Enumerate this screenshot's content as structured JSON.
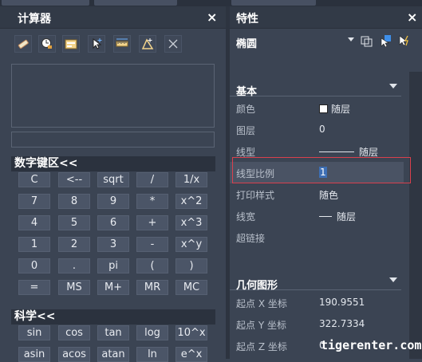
{
  "calculator": {
    "title": "计算器",
    "close": "×",
    "toolbar_icons": [
      "eraser-icon",
      "clock-icon",
      "units-icon",
      "pick-point-icon",
      "measure-distance-icon",
      "angle-icon",
      "close-x-icon"
    ],
    "display_value": "",
    "input_value": "",
    "numpad": {
      "header": "数字键区<<",
      "rows": [
        [
          "C",
          "<--",
          "sqrt",
          "/",
          "1/x"
        ],
        [
          "7",
          "8",
          "9",
          "*",
          "x^2"
        ],
        [
          "4",
          "5",
          "6",
          "+",
          "x^3"
        ],
        [
          "1",
          "2",
          "3",
          "-",
          "x^y"
        ],
        [
          "0",
          ".",
          "pi",
          "(",
          ")"
        ],
        [
          "=",
          "MS",
          "M+",
          "MR",
          "MC"
        ]
      ]
    },
    "science": {
      "header": "科学<<",
      "rows": [
        [
          "sin",
          "cos",
          "tan",
          "log",
          "10^x"
        ],
        [
          "asin",
          "acos",
          "atan",
          "ln",
          "e^x"
        ]
      ]
    }
  },
  "properties": {
    "title": "特性",
    "close": "×",
    "object_type": "椭圆",
    "icons": [
      "select-objects-icon",
      "quick-select-icon",
      "toggle-pickadd-icon"
    ],
    "groups": {
      "general": {
        "title": "基本",
        "rows": [
          {
            "name": "颜色",
            "value": "随层",
            "swatch": "#ffffff"
          },
          {
            "name": "图层",
            "value": "0"
          },
          {
            "name": "线型",
            "value": "随层"
          },
          {
            "name": "线型比例",
            "value": "1"
          },
          {
            "name": "打印样式",
            "value": "随色"
          },
          {
            "name": "线宽",
            "value": "随层"
          },
          {
            "name": "超链接",
            "value": ""
          }
        ]
      },
      "geometry": {
        "title": "几何图形",
        "rows": [
          {
            "name": "起点 X 坐标",
            "value": "190.9551"
          },
          {
            "name": "起点 Y 坐标",
            "value": "322.7334"
          },
          {
            "name": "起点 Z 坐标",
            "value": "0"
          }
        ]
      }
    }
  },
  "watermark": "tigerenter.com",
  "colors": {
    "highlight_box": "#d9404d",
    "selection": "#3e6fb4"
  }
}
